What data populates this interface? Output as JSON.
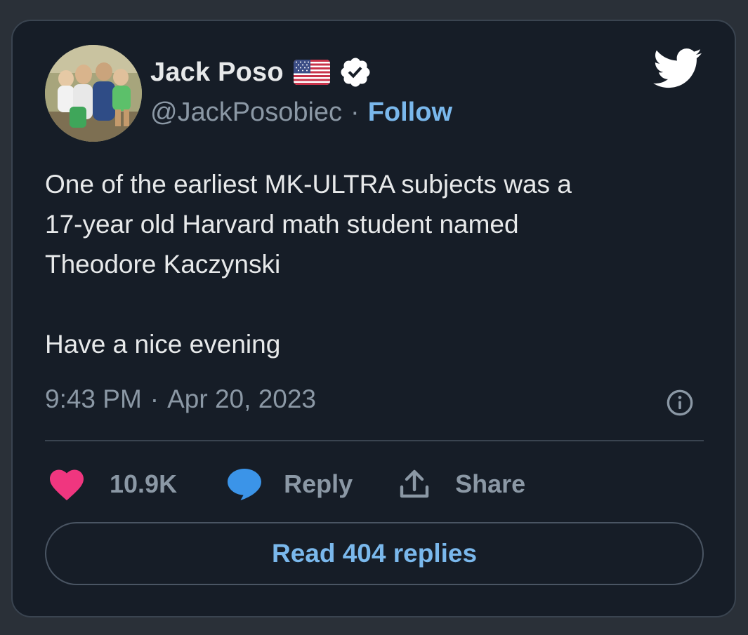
{
  "tweet": {
    "author": {
      "display_name": "Jack Poso",
      "handle": "@JackPosobiec",
      "follow_label": "Follow",
      "badges": [
        "us-flag-icon",
        "verified-badge-icon"
      ]
    },
    "text": "One of the earliest MK-ULTRA subjects was a\n17-year old Harvard math student named\nTheodore Kaczynski\n\nHave a nice evening",
    "time": "9:43 PM",
    "date": "Apr 20, 2023",
    "separator": "·",
    "likes": "10.9K",
    "reply_label": "Reply",
    "share_label": "Share",
    "read_replies_label": "Read 404 replies"
  },
  "icons": {
    "brand": "twitter-bird-icon",
    "info": "info-icon",
    "like": "heart-icon",
    "reply": "speech-bubble-icon",
    "share": "share-upload-icon"
  },
  "colors": {
    "card_background": "#161d27",
    "page_background": "#2a3038",
    "text_primary": "#e7e9ea",
    "text_secondary": "#8b98a5",
    "accent_blue": "#7ab8ec",
    "heart_pink": "#f0367f",
    "reply_blue": "#3b94e8",
    "border": "#3a4450"
  }
}
